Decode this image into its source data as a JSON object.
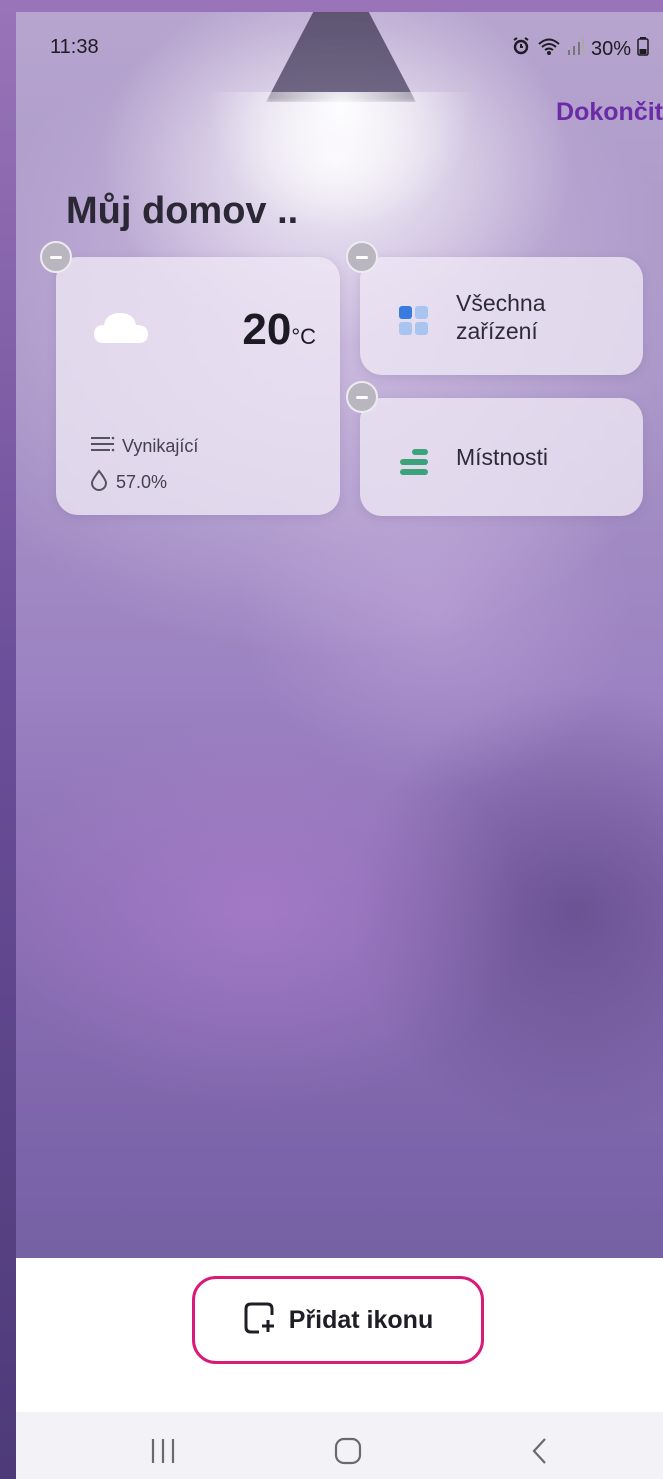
{
  "status_bar": {
    "time": "11:38",
    "battery": "30%",
    "icons": [
      "alarm-icon",
      "wifi-icon",
      "signal-icon",
      "battery-icon"
    ]
  },
  "header": {
    "done_label": "Dokončit",
    "title": "Můj domov .."
  },
  "weather_card": {
    "icon": "cloud-icon",
    "temperature": "20",
    "unit": "°C",
    "quality": "Vynikající",
    "humidity": "57.0%"
  },
  "devices_card": {
    "icon": "grid-icon",
    "label": "Všechna zařízení"
  },
  "rooms_card": {
    "icon": "rooms-icon",
    "label": "Místnosti"
  },
  "bottom": {
    "add_label": "Přidat ikonu"
  },
  "navigation": {
    "items": [
      "recents-icon",
      "home-icon",
      "back-icon"
    ]
  },
  "colors": {
    "accent": "#6b2aa6",
    "highlight_border": "#d81b7a",
    "rooms_icon": "#3aa37a",
    "grid_icon_primary": "#3a7be0",
    "grid_icon_secondary": "#a9c4ef"
  }
}
